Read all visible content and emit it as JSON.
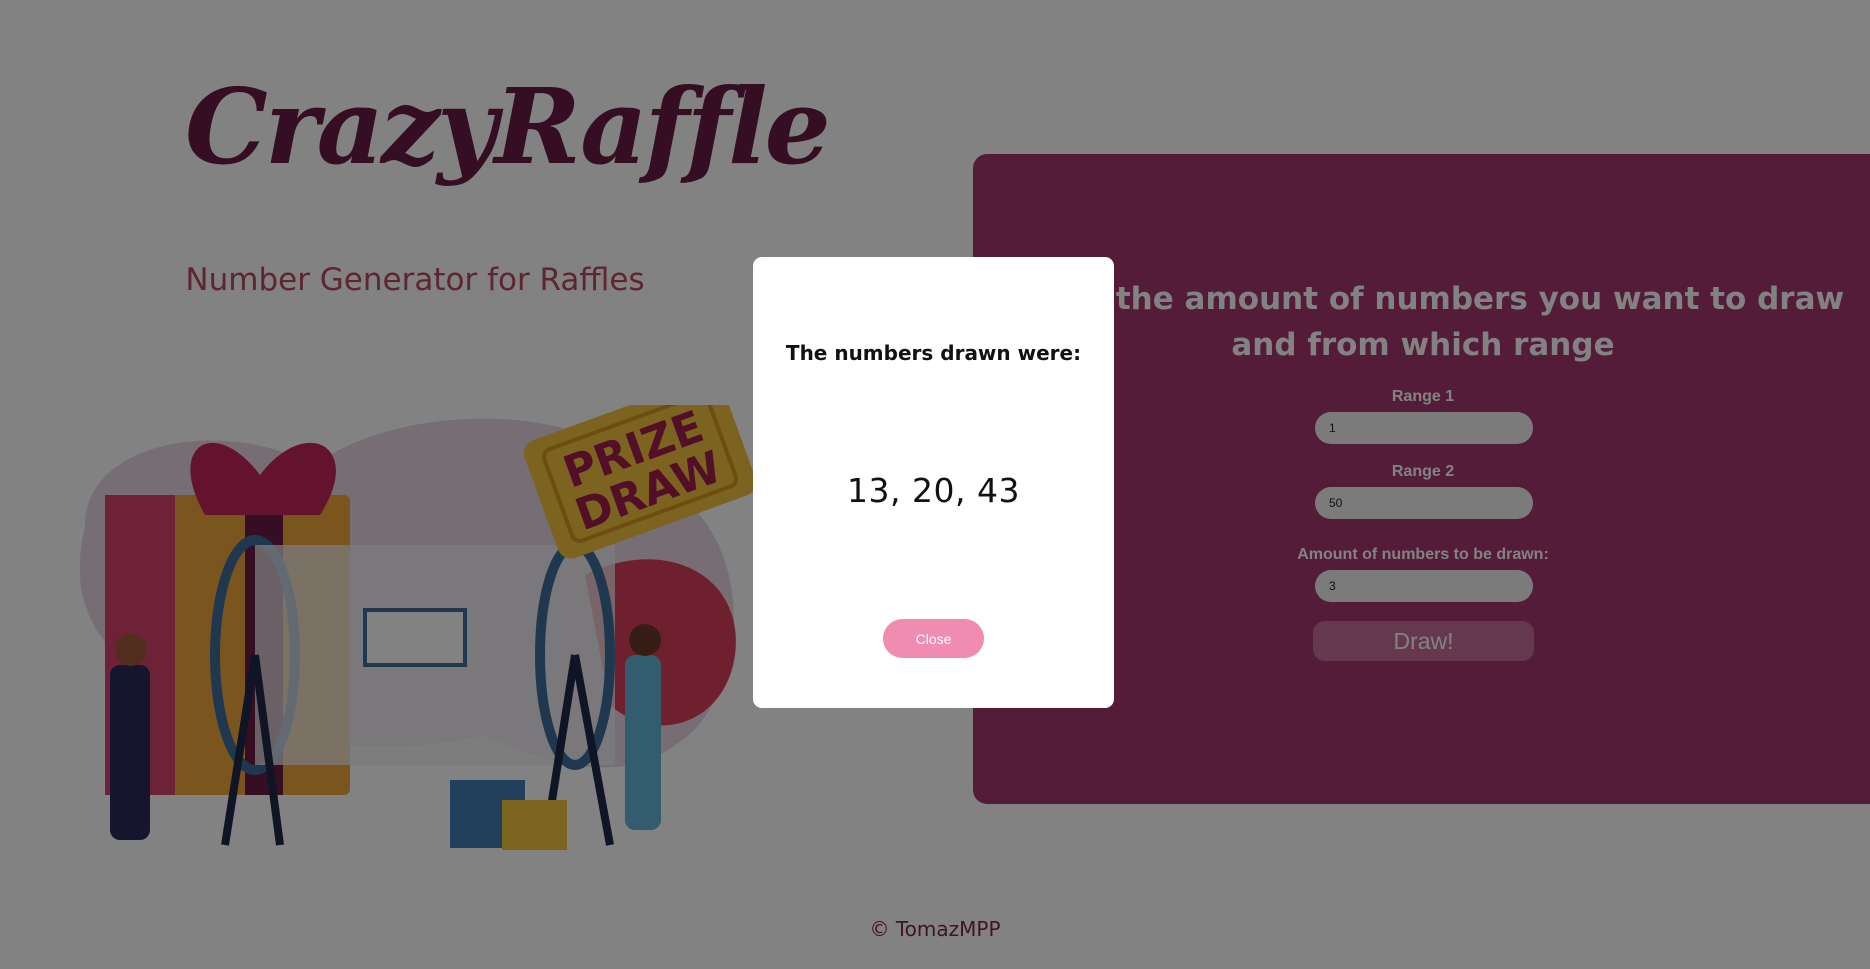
{
  "app": {
    "logo": "CrazyRaffle",
    "subtitle": "Number Generator for Raffles",
    "footer": "© TomazMPP"
  },
  "illustration": {
    "icon": "prize-draw-illustration",
    "ticket_line1": "PRIZE",
    "ticket_line2": "DRAW"
  },
  "form": {
    "heading_line1": "Insert the amount of numbers you want to draw",
    "heading_line2": "and from which range",
    "range1_label": "Range 1",
    "range1_value": "1",
    "range2_label": "Range 2",
    "range2_value": "50",
    "amount_label": "Amount of numbers to be drawn:",
    "amount_value": "3",
    "draw_label": "Draw!"
  },
  "modal": {
    "title": "The numbers drawn were:",
    "result": "13, 20, 43",
    "close_label": "Close"
  },
  "colors": {
    "brand": "#6b1d46",
    "panel": "#a73873",
    "subtitle": "#b94a63",
    "close_button": "#f08cb0",
    "draw_button": "#c86f98"
  }
}
